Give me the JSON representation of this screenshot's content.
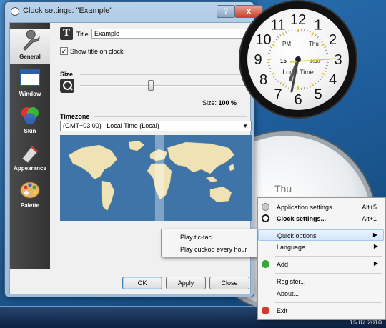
{
  "window": {
    "title": "Clock settings: \"Example\"",
    "help_label": "?",
    "close_label": "x"
  },
  "sidebar": {
    "items": [
      {
        "label": "General",
        "icon": "wrench-icon",
        "active": true
      },
      {
        "label": "Window",
        "icon": "window-icon",
        "active": false
      },
      {
        "label": "Skin",
        "icon": "skin-icon",
        "active": false
      },
      {
        "label": "Appearance",
        "icon": "appearance-icon",
        "active": false
      },
      {
        "label": "Palette",
        "icon": "palette-icon",
        "active": false
      }
    ]
  },
  "general": {
    "title_label": "Title",
    "title_value": "Example",
    "show_title_checked": true,
    "show_title_label": "Show title on clock",
    "size_section": "Size",
    "size_value_label": "Size:",
    "size_value": "100 %",
    "size_fraction": 0.42,
    "timezone_section": "Timezone",
    "timezone_value": "(GMT+03:00) : Local Time (Local)"
  },
  "buttons": {
    "ok": "OK",
    "apply": "Apply",
    "close": "Close"
  },
  "submenu": {
    "items": [
      "Play tic-tac",
      "Play cuckoo every hour"
    ]
  },
  "clock": {
    "numbers": [
      "12",
      "1",
      "2",
      "3",
      "4",
      "5",
      "6",
      "7",
      "8",
      "9",
      "10",
      "11"
    ],
    "am_pm": "PM",
    "day": "Thu",
    "date_num": "15",
    "year": "2010",
    "label": "Local Time"
  },
  "background_clock": {
    "day": "Thu"
  },
  "context_menu": {
    "items": [
      {
        "label": "Application settings...",
        "shortcut": "Alt+5",
        "icon": "gear-icon"
      },
      {
        "label": "Clock settings...",
        "shortcut": "Alt+1",
        "icon": "clock-icon",
        "bold": true
      },
      {
        "label": "Quick options",
        "submenu": true,
        "highlighted": true
      },
      {
        "label": "Language",
        "submenu": true
      },
      {
        "label": "Add",
        "submenu": true,
        "icon": "add-icon"
      },
      {
        "label": "Register..."
      },
      {
        "label": "About..."
      },
      {
        "label": "Exit",
        "icon": "exit-icon"
      }
    ]
  },
  "taskbar": {
    "date": "15.07.2010"
  },
  "colors": {
    "map_ocean": "#3e74a8",
    "map_land": "#efe2b4",
    "highlight": "#d5e6fb"
  }
}
